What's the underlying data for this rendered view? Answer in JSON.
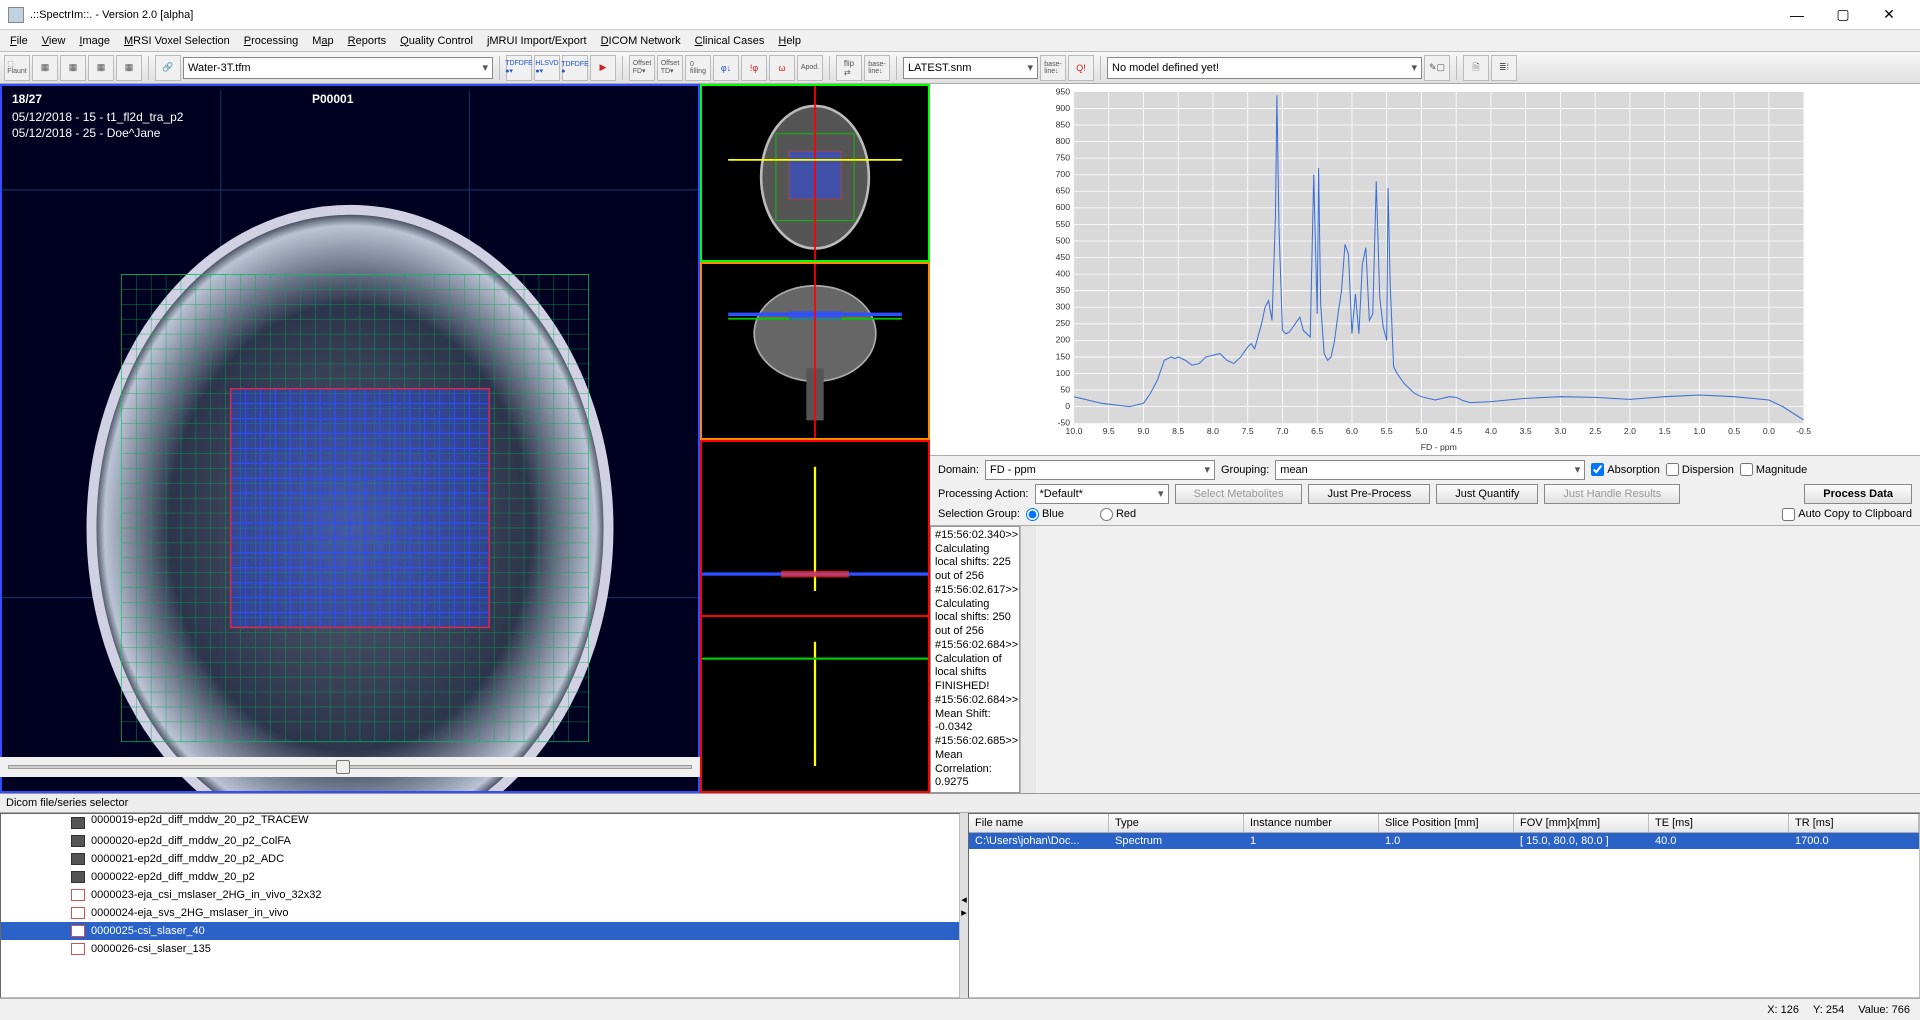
{
  "window": {
    "title": ".::SpectrIm::.   -   Version 2.0 [alpha]"
  },
  "menu": [
    "File",
    "View",
    "Image",
    "MRSI Voxel Selection",
    "Processing",
    "Map",
    "Reports",
    "Quality Control",
    "jMRUI Import/Export",
    "DICOM Network",
    "Clinical Cases",
    "Help"
  ],
  "toolbar": {
    "filter_sel": "Water-3T.tfm",
    "latest_sel": "LATEST.snm",
    "model_sel": "No model defined yet!"
  },
  "viewer": {
    "counter": "18/27",
    "patient_id": "P00001",
    "line1": "05/12/2018 - 15 - t1_fl2d_tra_p2",
    "line2": "05/12/2018 - 25 - Doe^Jane"
  },
  "controls": {
    "domain_label": "Domain:",
    "domain_value": "FD - ppm",
    "grouping_label": "Grouping:",
    "grouping_value": "mean",
    "absorption": "Absorption",
    "dispersion": "Dispersion",
    "magnitude": "Magnitude",
    "pa_label": "Processing Action:",
    "pa_value": "*Default*",
    "btn_selmet": "Select Metabolites",
    "btn_pre": "Just Pre-Process",
    "btn_quant": "Just Quantify",
    "btn_handle": "Just Handle Results",
    "btn_process": "Process Data",
    "sg_label": "Selection Group:",
    "sg_blue": "Blue",
    "sg_red": "Red",
    "autocopy": "Auto Copy to Clipboard"
  },
  "log": [
    "#15:56:02.340>> Calculating local shifts: 225 out of 256",
    "#15:56:02.617>> Calculating local shifts: 250 out of 256",
    "#15:56:02.684>> Calculation of local shifts FINISHED!",
    "#15:56:02.684>> Mean Shift: -0.0342",
    "#15:56:02.685>> Mean Correlation: 0.9275"
  ],
  "panel": {
    "title": "Dicom file/series selector"
  },
  "tree": [
    {
      "icon": "d",
      "label": "0000019-ep2d_diff_mddw_20_p2_TRACEW",
      "cut": true
    },
    {
      "icon": "d",
      "label": "0000020-ep2d_diff_mddw_20_p2_ColFA"
    },
    {
      "icon": "d",
      "label": "0000021-ep2d_diff_mddw_20_p2_ADC"
    },
    {
      "icon": "d",
      "label": "0000022-ep2d_diff_mddw_20_p2"
    },
    {
      "icon": "s",
      "label": "0000023-eja_csi_mslaser_2HG_in_vivo_32x32"
    },
    {
      "icon": "s",
      "label": "0000024-eja_svs_2HG_mslaser_in_vivo"
    },
    {
      "icon": "s",
      "label": "0000025-csi_slaser_40",
      "sel": true
    },
    {
      "icon": "s",
      "label": "0000026-csi_slaser_135"
    }
  ],
  "table": {
    "headers": [
      "File name",
      "Type",
      "Instance number",
      "Slice Position [mm]",
      "FOV [mm]x[mm]",
      "TE [ms]",
      "TR [ms]"
    ],
    "row": [
      "C:\\Users\\johan\\Doc...",
      "Spectrum",
      "1",
      "1.0",
      "[ 15.0, 80.0, 80.0 ]",
      "40.0",
      "1700.0"
    ]
  },
  "status": {
    "x": "X: 126",
    "y": "Y: 254",
    "v": "Value:    766"
  },
  "chart_data": {
    "type": "line",
    "title": "",
    "xlabel": "FD - ppm",
    "ylabel": "",
    "xlim": [
      10.0,
      -0.5
    ],
    "ylim": [
      -50,
      950
    ],
    "xticks": [
      10.0,
      9.5,
      9.0,
      8.5,
      8.0,
      7.5,
      7.0,
      6.5,
      6.0,
      5.5,
      5.0,
      4.5,
      4.0,
      3.5,
      3.0,
      2.5,
      2.0,
      1.5,
      1.0,
      0.5,
      0.0,
      -0.5
    ],
    "yticks": [
      -50,
      0,
      50,
      100,
      150,
      200,
      250,
      300,
      350,
      400,
      450,
      500,
      550,
      600,
      650,
      700,
      750,
      800,
      850,
      900,
      950
    ],
    "series": [
      {
        "name": "spectrum",
        "color": "#3b6fd6",
        "x": [
          10.0,
          9.6,
          9.4,
          9.2,
          9.0,
          8.9,
          8.8,
          8.7,
          8.6,
          8.55,
          8.5,
          8.4,
          8.3,
          8.2,
          8.1,
          8.0,
          7.9,
          7.8,
          7.7,
          7.6,
          7.5,
          7.45,
          7.4,
          7.3,
          7.25,
          7.2,
          7.15,
          7.1,
          7.08,
          7.05,
          7.0,
          6.95,
          6.9,
          6.85,
          6.8,
          6.75,
          6.7,
          6.6,
          6.55,
          6.5,
          6.48,
          6.45,
          6.4,
          6.35,
          6.3,
          6.25,
          6.2,
          6.15,
          6.1,
          6.05,
          6.0,
          5.95,
          5.9,
          5.85,
          5.8,
          5.75,
          5.7,
          5.65,
          5.6,
          5.55,
          5.5,
          5.48,
          5.45,
          5.4,
          5.35,
          5.3,
          5.25,
          5.2,
          5.1,
          5.0,
          4.9,
          4.8,
          4.7,
          4.6,
          4.5,
          4.4,
          4.3,
          4.0,
          3.5,
          3.0,
          2.5,
          2.0,
          1.5,
          1.0,
          0.5,
          0.0,
          -0.2,
          -0.5
        ],
        "y": [
          30,
          10,
          5,
          0,
          10,
          40,
          80,
          140,
          150,
          145,
          150,
          140,
          125,
          130,
          150,
          155,
          160,
          140,
          130,
          150,
          180,
          190,
          175,
          250,
          300,
          320,
          260,
          580,
          940,
          540,
          230,
          220,
          225,
          240,
          255,
          270,
          230,
          210,
          700,
          280,
          720,
          310,
          160,
          140,
          150,
          200,
          280,
          350,
          490,
          460,
          220,
          340,
          220,
          430,
          480,
          260,
          280,
          680,
          330,
          240,
          200,
          660,
          370,
          120,
          100,
          85,
          70,
          60,
          40,
          30,
          25,
          20,
          25,
          30,
          28,
          18,
          12,
          15,
          25,
          30,
          28,
          22,
          30,
          35,
          30,
          20,
          0,
          -40
        ]
      }
    ]
  }
}
